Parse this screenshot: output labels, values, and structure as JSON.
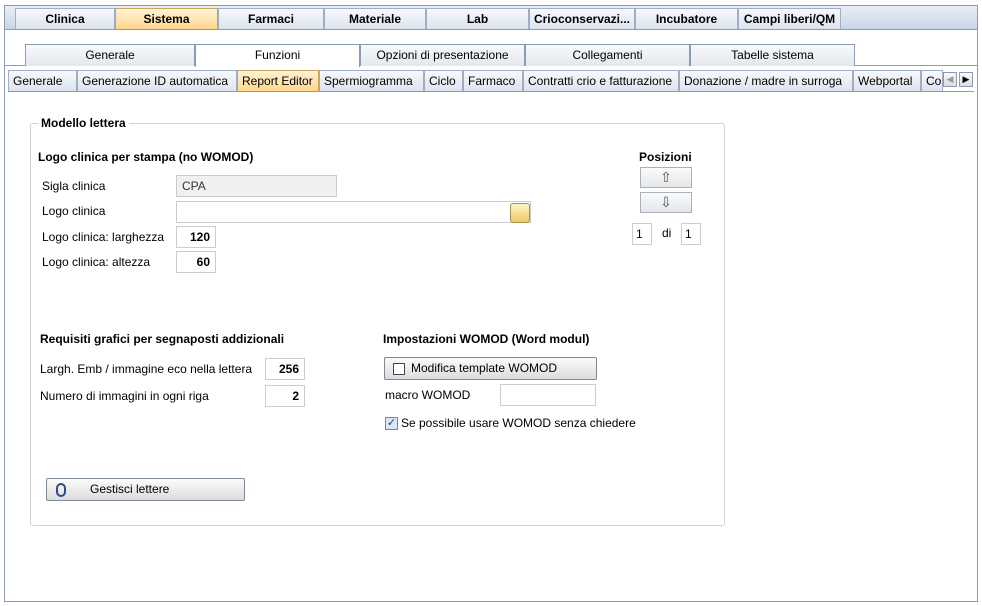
{
  "top_tabs": [
    "Clinica",
    "Sistema",
    "Farmaci",
    "Materiale",
    "Lab",
    "Crioconservazi...",
    "Incubatore",
    "Campi liberi/QM"
  ],
  "second_tabs": [
    "Generale",
    "Funzioni",
    "Opzioni di presentazione",
    "Collegamenti",
    "Tabelle sistema"
  ],
  "third_tabs": [
    "Generale",
    "Generazione ID automatica",
    "Report Editor",
    "Spermiogramma",
    "Ciclo",
    "Farmaco",
    "Contratti crio e fatturazione",
    "Donazione / madre in surroga",
    "Webportal",
    "Co"
  ],
  "group": {
    "title": "Modello lettera",
    "logo_section_title": "Logo clinica per stampa (no WOMOD)",
    "sigla_label": "Sigla clinica",
    "sigla_value": "CPA",
    "logo_label": "Logo clinica",
    "logo_value": "",
    "width_label": "Logo clinica: larghezza",
    "width_value": "120",
    "height_label": "Logo clinica: altezza",
    "height_value": "60",
    "positions_title": "Posizioni",
    "pos_current": "1",
    "pos_of": "di",
    "pos_total": "1",
    "req_title": "Requisiti grafici per segnaposti addizionali",
    "emb_label": "Largh. Emb / immagine eco nella lettera",
    "emb_value": "256",
    "num_images_label": "Numero di immagini in ogni riga",
    "num_images_value": "2",
    "womod_title": "Impostazioni WOMOD (Word modul)",
    "womod_button": "Modifica template WOMOD",
    "macro_label": "macro WOMOD",
    "macro_value": "",
    "checkbox_label": "Se possibile usare WOMOD senza chiedere",
    "checkbox_checked": true,
    "manage_button": "Gestisci lettere"
  },
  "icons": {
    "up": "⇧",
    "down": "⇩",
    "check": "✓",
    "scroll_left": "◀",
    "scroll_right": "▶"
  },
  "colors": {
    "active_tab": "#ffd68c",
    "border": "#8a9bb3"
  }
}
